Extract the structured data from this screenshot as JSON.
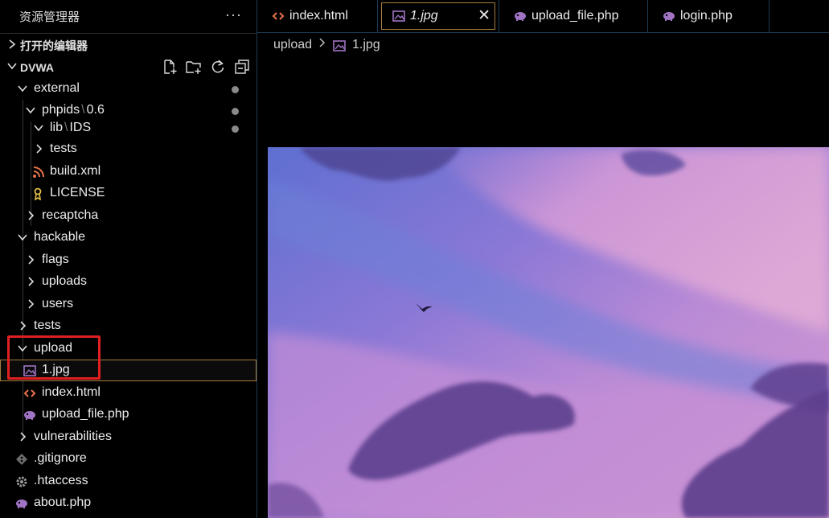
{
  "sidebar": {
    "title": "资源管理器",
    "more_label": "···",
    "open_editors": "打开的编辑器",
    "root": "DVWA",
    "tree": [
      {
        "label": "external",
        "dot": true
      },
      {
        "label": "phpids",
        "suffix": "0.6",
        "dot": true
      },
      {
        "label": "lib",
        "suffix": "IDS",
        "dot": true
      },
      {
        "label": "tests"
      },
      {
        "label": "build.xml"
      },
      {
        "label": "LICENSE"
      },
      {
        "label": "recaptcha"
      },
      {
        "label": "hackable"
      },
      {
        "label": "flags"
      },
      {
        "label": "uploads"
      },
      {
        "label": "users"
      },
      {
        "label": "tests"
      },
      {
        "label": "upload"
      },
      {
        "label": "1.jpg"
      },
      {
        "label": "index.html"
      },
      {
        "label": "upload_file.php"
      },
      {
        "label": "vulnerabilities"
      },
      {
        "label": ".gitignore"
      },
      {
        "label": ".htaccess"
      },
      {
        "label": "about.php"
      }
    ]
  },
  "tabs": [
    {
      "label": "index.html",
      "icon": "html-icon"
    },
    {
      "label": "1.jpg",
      "icon": "image-icon",
      "active": true,
      "close": "✕"
    },
    {
      "label": "upload_file.php",
      "icon": "php-icon"
    },
    {
      "label": "login.php",
      "icon": "php-icon"
    }
  ],
  "breadcrumb": {
    "folder": "upload",
    "file": "1.jpg"
  },
  "colors": {
    "accent_border": "#a67c3a",
    "highlight": "#e02020",
    "html_icon": "#e8734a",
    "php_icon": "#a074c4",
    "image_icon": "#a074c4"
  }
}
